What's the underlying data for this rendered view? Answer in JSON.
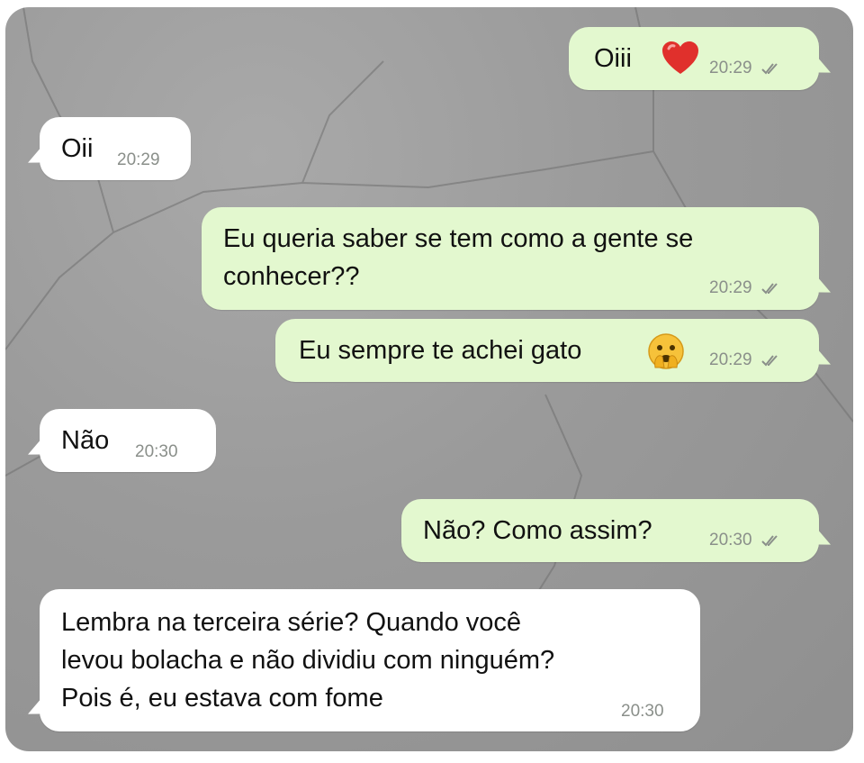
{
  "messages": [
    {
      "id": "m1",
      "direction": "outgoing",
      "text": "Oiii",
      "emoji": "heart",
      "time": "20:29",
      "status": "read"
    },
    {
      "id": "m2",
      "direction": "incoming",
      "text": "Oii",
      "time": "20:29"
    },
    {
      "id": "m3",
      "direction": "outgoing",
      "lines": [
        "Eu queria saber se tem como a gente se",
        "conhecer??"
      ],
      "time": "20:29",
      "status": "read"
    },
    {
      "id": "m4",
      "direction": "outgoing",
      "text": "Eu sempre te achei gato",
      "emoji": "shy-face",
      "time": "20:29",
      "status": "read"
    },
    {
      "id": "m5",
      "direction": "incoming",
      "text": "Não",
      "time": "20:30"
    },
    {
      "id": "m6",
      "direction": "outgoing",
      "text": "Não? Como assim?",
      "time": "20:30",
      "status": "read"
    },
    {
      "id": "m7",
      "direction": "incoming",
      "lines": [
        "Lembra na terceira série? Quando você",
        "levou bolacha e não dividiu com ninguém?",
        "Pois é, eu estava com fome"
      ],
      "time": "20:30"
    }
  ],
  "colors": {
    "outgoing_bubble": "#e3f8cf",
    "incoming_bubble": "#ffffff",
    "wallpaper": "#9a9a9a",
    "timestamp": "#8a8f8a"
  }
}
